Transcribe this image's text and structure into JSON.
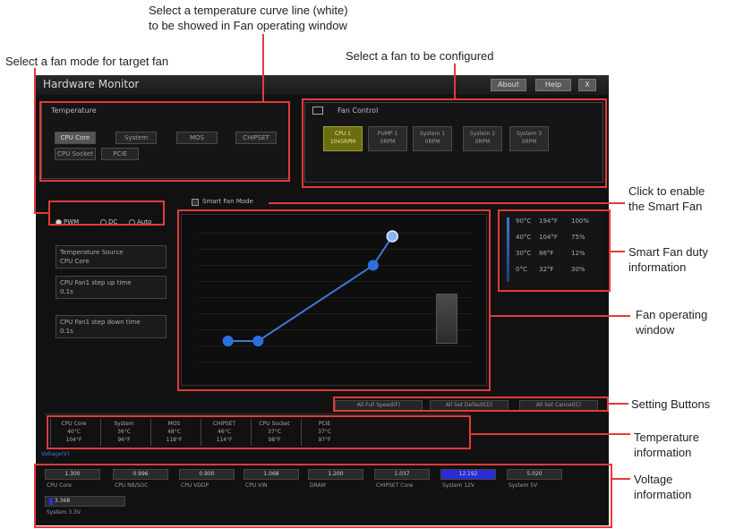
{
  "callouts": {
    "curve_line_1": "Select a temperature curve line (white)",
    "curve_line_2": "to be showed in Fan operating window",
    "fan_mode": "Select a fan mode for target fan",
    "select_fan": "Select a fan to be configured",
    "smart_fan_1": "Click to enable",
    "smart_fan_2": "the Smart Fan",
    "duty_1": "Smart Fan duty",
    "duty_2": "information",
    "window_1": "Fan operating",
    "window_2": "window",
    "setting": "Setting Buttons",
    "temp_1": "Temperature",
    "temp_2": "information",
    "volt_1": "Voltage",
    "volt_2": "information"
  },
  "app": {
    "title": "Hardware Monitor",
    "about": "About",
    "help": "Help",
    "close": "X"
  },
  "temperature": {
    "header": "Temperature",
    "buttons": [
      "CPU Core",
      "System",
      "MOS",
      "CHIPSET",
      "CPU Socket",
      "PCIE"
    ]
  },
  "fan_control": {
    "header": "Fan Control",
    "fans": [
      {
        "name": "CPU 1",
        "rpm": "1045RPM"
      },
      {
        "name": "PUMP 1",
        "rpm": "0RPM"
      },
      {
        "name": "System 1",
        "rpm": "0RPM"
      },
      {
        "name": "System 2",
        "rpm": "0RPM"
      },
      {
        "name": "System 3",
        "rpm": "0RPM"
      }
    ]
  },
  "fan_mode": {
    "pwm": "PWM",
    "dc": "DC",
    "auto": "Auto"
  },
  "smart_fan_mode": "Smart Fan Mode",
  "side": {
    "temp_source_label": "Temperature Source",
    "temp_source_value": "CPU Core",
    "step_up_label": "CPU Fan1 step up time",
    "step_up_value": "0.1s",
    "step_down_label": "CPU Fan1 step down time",
    "step_down_value": "0.1s"
  },
  "duty": [
    {
      "temp": "90°C",
      "deg_f": "194°F",
      "pct": "100%"
    },
    {
      "temp": "40°C",
      "deg_f": "104°F",
      "pct": "75%"
    },
    {
      "temp": "30°C",
      "deg_f": "86°F",
      "pct": "12%"
    },
    {
      "temp": "0°C",
      "deg_f": "32°F",
      "pct": "30%"
    }
  ],
  "setting_buttons": [
    "All Full Speed(F)",
    "All Set Default(D)",
    "All Set Cancel(C)"
  ],
  "temps": [
    {
      "name": "CPU Core",
      "c": "40°C",
      "f": "104°F"
    },
    {
      "name": "System",
      "c": "36°C",
      "f": "96°F"
    },
    {
      "name": "MOS",
      "c": "48°C",
      "f": "118°F"
    },
    {
      "name": "CHIPSET",
      "c": "46°C",
      "f": "114°F"
    },
    {
      "name": "CPU Socket",
      "c": "37°C",
      "f": "98°F"
    },
    {
      "name": "PCIE",
      "c": "37°C",
      "f": "97°F"
    }
  ],
  "voltage_header": "Voltage(V)",
  "voltages": [
    {
      "value": "1.300",
      "name": "CPU Core"
    },
    {
      "value": "0.996",
      "name": "CPU NB/SOC"
    },
    {
      "value": "0.900",
      "name": "CPU VDDP"
    },
    {
      "value": "1.068",
      "name": "CPU VIN"
    },
    {
      "value": "1.200",
      "name": "DRAM"
    },
    {
      "value": "1.037",
      "name": "CHIPSET Core"
    },
    {
      "value": "12.192",
      "name": "System 12V"
    },
    {
      "value": "5.020",
      "name": "System 5V"
    },
    {
      "value": "3.368",
      "name": "System 3.3V"
    }
  ],
  "chart_data": {
    "type": "line",
    "points": [
      [
        11,
        25
      ],
      [
        22,
        25
      ],
      [
        64,
        72
      ],
      [
        71,
        90
      ]
    ]
  }
}
